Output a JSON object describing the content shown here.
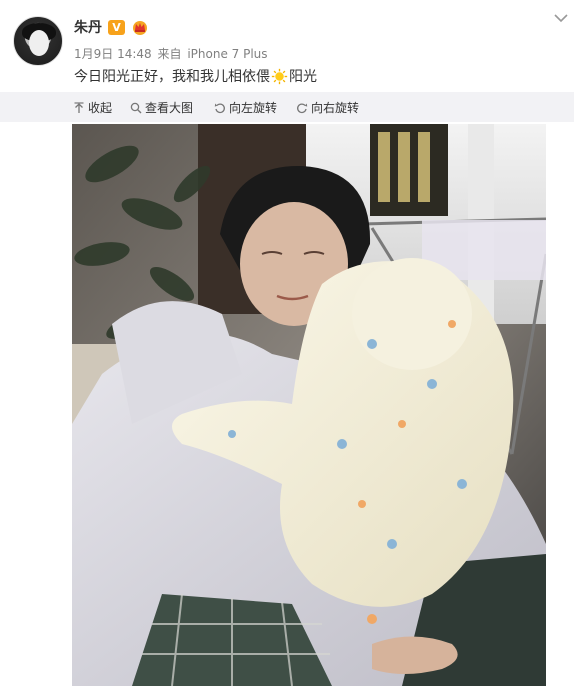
{
  "post": {
    "username": "朱丹",
    "verified_badge": "V",
    "date": "1月9日 14:48",
    "source_prefix": "来自",
    "source": "iPhone 7 Plus",
    "text_before_icon": "今日阳光正好，我和我儿相依偎",
    "text_after_icon": "阳光",
    "inline_icon": "sun-emoji"
  },
  "toolbar": {
    "collapse_label": "收起",
    "view_large_label": "查看大图",
    "rotate_left_label": "向左旋转",
    "rotate_right_label": "向右旋转"
  },
  "icons": {
    "badge_color": "#f7a21b",
    "crown_icon": "crown-icon",
    "menu_icon": "chevron-down-icon"
  },
  "image": {
    "alt": "photo"
  }
}
